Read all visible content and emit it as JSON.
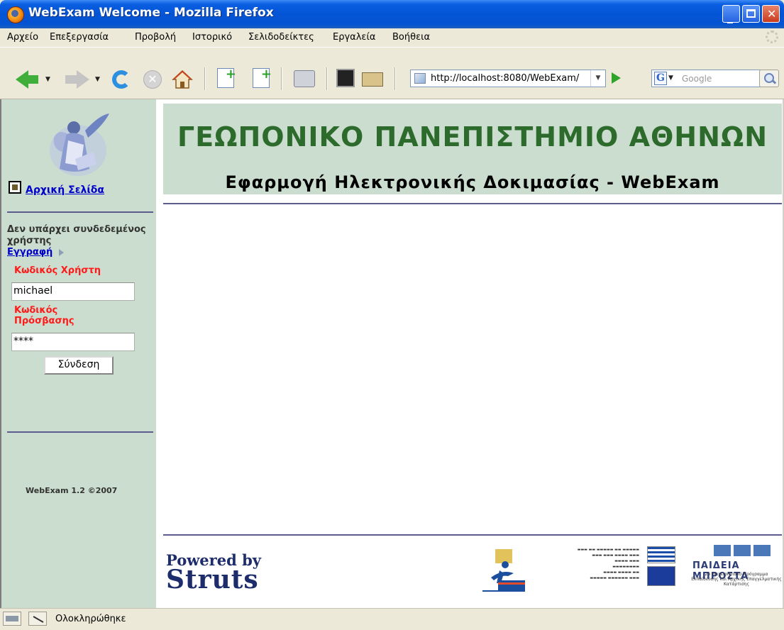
{
  "window": {
    "title": "WebExam Welcome - Mozilla Firefox"
  },
  "menu": {
    "items": [
      "Αρχείο",
      "Επεξεργασία",
      "Προβολή",
      "Ιστορικό",
      "Σελιδοδείκτες",
      "Εργαλεία",
      "Βοήθεια"
    ]
  },
  "toolbar": {
    "url": "http://localhost:8080/WebExam/",
    "search_placeholder": "Google"
  },
  "sidebar": {
    "home_link": "Αρχική Σελίδα",
    "no_user_text": "Δεν υπάρχει συνδεδεμένος χρήστης",
    "register_link": "Εγγραφή",
    "username_label": "Κωδικός Χρήστη",
    "username_value": "michael",
    "password_label": "Κωδικός Πρόσβασης",
    "password_value": "****",
    "login_button": "Σύνδεση",
    "copyright": "WebExam 1.2 ©2007"
  },
  "header": {
    "university": "ΓΕΩΠΟΝΙΚΟ ΠΑΝΕΠΙΣΤΗΜΙΟ ΑΘΗΝΩΝ",
    "app_title": "Εφαρμογή Ηλεκτρονικής Δοκιμασίας - WebExam"
  },
  "footer": {
    "powered_by": "Powered by",
    "struts": "Struts",
    "paideia_title": "ΠΑΙΔΕΙΑ ΜΠΡΟΣΤΑ",
    "paideia_subtitle": "2ο Επιχειρησιακό Πρόγραμμα Εκπαίδευσης και Αρχικής Επαγγελματικής Κατάρτισης"
  },
  "status": {
    "text": "Ολοκληρώθηκε"
  },
  "colors": {
    "sidebar_bg": "#cbddce",
    "header_title": "#2d6b2d",
    "link": "#0000cc",
    "label_red": "#ff1a1a"
  }
}
